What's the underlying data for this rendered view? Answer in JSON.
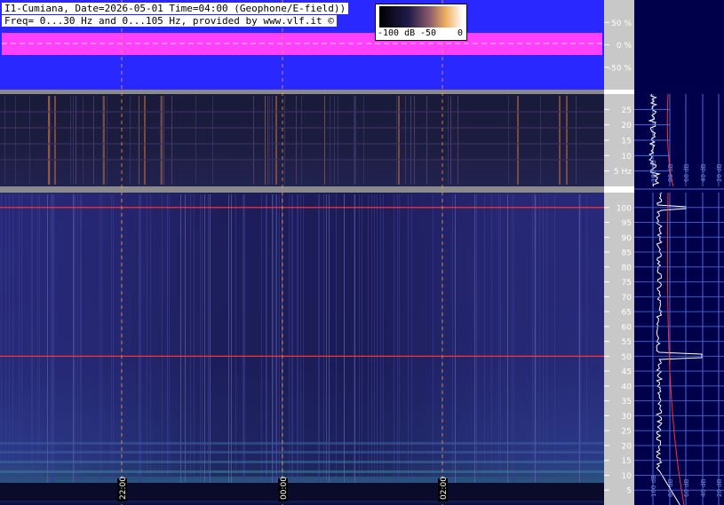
{
  "header": {
    "line1": "I1-Cumiana, Date=2026-05-01 Time=04:00 (Geophone/E-field))",
    "line2": "Freq= 0...30 Hz and 0...105 Hz, provided by www.vlf.it ©"
  },
  "colorbar": {
    "labels": [
      "-100 dB",
      "-50",
      "0"
    ]
  },
  "colors": {
    "amp_bg": "#2828ff",
    "amp_trace": "#ff40ff",
    "spectro_low": "#20206e",
    "line_red": "#ff3030",
    "axis_bg": "#c8c8c8",
    "side_bg": "#00004a",
    "side_grid": "#4a6ad0",
    "marker": "#ffa040"
  },
  "chart_data": [
    {
      "type": "line",
      "panel": "amplitude",
      "y_tick_labels": [
        "50 %",
        "0 %",
        "-50 %"
      ],
      "y_ticks": [
        50,
        0,
        -50
      ],
      "ylim": [
        -100,
        100
      ]
    },
    {
      "type": "heatmap",
      "panel": "spectrogram-0-30Hz",
      "y_tick_labels": [
        "25",
        "20",
        "15",
        "10",
        "5 Hz"
      ],
      "y_ticks": [
        25,
        20,
        15,
        10,
        5
      ],
      "ylim": [
        0,
        30
      ]
    },
    {
      "type": "heatmap",
      "panel": "spectrogram-0-105Hz",
      "y_tick_labels": [
        "100",
        "95",
        "90",
        "85",
        "80",
        "75",
        "70",
        "65",
        "60",
        "55",
        "50",
        "45",
        "40",
        "35",
        "30",
        "25",
        "20",
        "15",
        "10",
        "5"
      ],
      "y_ticks": [
        100,
        95,
        90,
        85,
        80,
        75,
        70,
        65,
        60,
        55,
        50,
        45,
        40,
        35,
        30,
        25,
        20,
        15,
        10,
        5
      ],
      "ylim": [
        0,
        105
      ],
      "x_tick_labels": [
        "22:00",
        "00:00",
        "02:00"
      ],
      "highlighted_lines_hz": [
        100,
        50
      ]
    },
    {
      "type": "line",
      "panel": "spectrum-profile-top",
      "x_tick_labels": [
        "100 dB",
        "80 dB",
        "60 dB",
        "40 dB",
        "20 dB"
      ]
    },
    {
      "type": "line",
      "panel": "spectrum-profile-bottom",
      "x_tick_labels": [
        "100 dB",
        "80 dB",
        "60 dB",
        "40 dB",
        "20 dB"
      ]
    }
  ]
}
